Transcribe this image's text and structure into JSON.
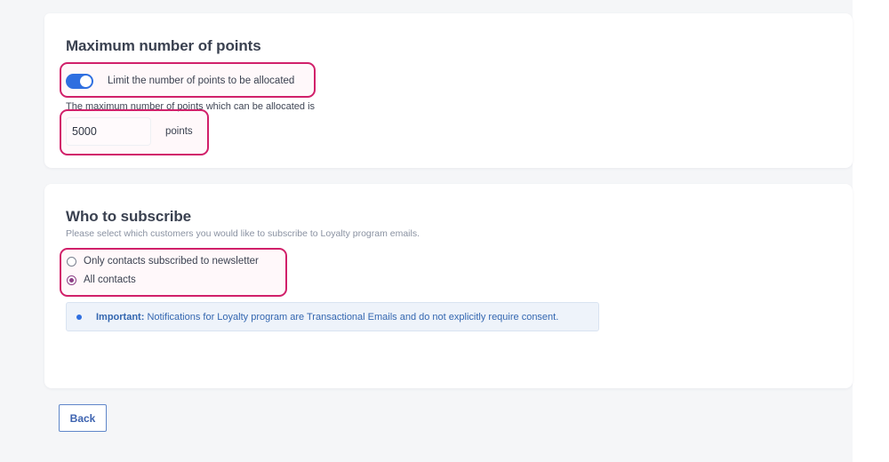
{
  "max_points": {
    "title": "Maximum number of points",
    "toggle_label": "Limit the number of points to be allocated",
    "toggle_on": true,
    "description": "The maximum number of points which can be allocated is",
    "points_value": "5000",
    "points_unit": "points"
  },
  "subscribe": {
    "title": "Who to subscribe",
    "subtitle": "Please select which customers you would like to subscribe to Loyalty program emails.",
    "options": [
      {
        "label": "Only contacts subscribed to newsletter",
        "checked": false
      },
      {
        "label": "All contacts",
        "checked": true
      }
    ],
    "notice_strong": "Important:",
    "notice_text": " Notifications for Loyalty program are Transactional Emails and do not explicitly require consent."
  },
  "footer": {
    "back_label": "Back"
  },
  "colors": {
    "accent": "#2f6fe0",
    "highlight": "#d1206a",
    "radio_checked": "#8e3f86"
  },
  "icons": {
    "toggle": "toggle-switch",
    "notice_bullet": "bullet-dot-icon"
  }
}
